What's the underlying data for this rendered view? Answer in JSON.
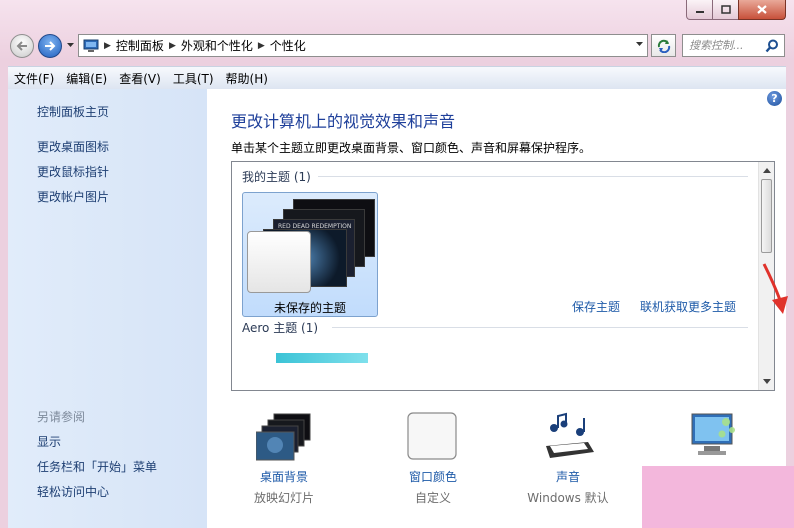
{
  "address": {
    "crumbs": [
      "控制面板",
      "外观和个性化",
      "个性化"
    ],
    "search_placeholder": "搜索控制..."
  },
  "menu": [
    "文件(F)",
    "编辑(E)",
    "查看(V)",
    "工具(T)",
    "帮助(H)"
  ],
  "sidebar": {
    "links": [
      "控制面板主页",
      "更改桌面图标",
      "更改鼠标指针",
      "更改帐户图片"
    ],
    "see_also_title": "另请参阅",
    "see_also": [
      "显示",
      "任务栏和「开始」菜单",
      "轻松访问中心"
    ]
  },
  "main": {
    "title": "更改计算机上的视觉效果和声音",
    "description": "单击某个主题立即更改桌面背景、窗口颜色、声音和屏幕保护程序。",
    "my_themes_header": "我的主题 (1)",
    "unsaved_theme_label": "未保存的主题",
    "card_text": "RED DEAD REDEMPTION",
    "save_theme_link": "保存主题",
    "get_more_link": "联机获取更多主题",
    "aero_header": "Aero 主题 (1)"
  },
  "bottom": [
    {
      "label": "桌面背景",
      "sub": "放映幻灯片"
    },
    {
      "label": "窗口颜色",
      "sub": "自定义"
    },
    {
      "label": "声音",
      "sub": "Windows 默认"
    }
  ],
  "colors": {
    "title_blue": "#1e3f9a",
    "link_blue": "#1e5aa8",
    "annotation_red": "#e0322b",
    "window_frame": "#f6e3ee"
  }
}
